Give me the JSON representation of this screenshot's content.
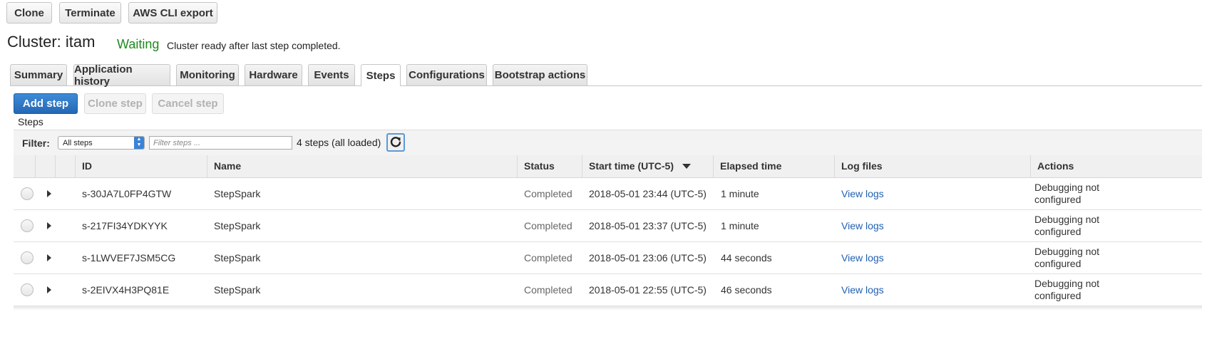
{
  "toolbar": {
    "clone": "Clone",
    "terminate": "Terminate",
    "aws_cli_export": "AWS CLI export"
  },
  "cluster": {
    "title": "Cluster: itam",
    "state": "Waiting",
    "message": "Cluster ready after last step completed."
  },
  "tabs": [
    "Summary",
    "Application history",
    "Monitoring",
    "Hardware",
    "Events",
    "Steps",
    "Configurations",
    "Bootstrap actions"
  ],
  "active_tab": "Steps",
  "step_actions": {
    "add": "Add step",
    "clone": "Clone step",
    "cancel": "Cancel step"
  },
  "steps_section_label": "Steps",
  "filter": {
    "label": "Filter:",
    "selected": "All steps",
    "placeholder": "Filter steps ...",
    "count_text": "4 steps (all loaded)"
  },
  "table": {
    "columns": [
      "ID",
      "Name",
      "Status",
      "Start time (UTC-5)",
      "Elapsed time",
      "Log files",
      "Actions"
    ],
    "sorted_column": "Start time (UTC-5)",
    "sort_direction": "descending",
    "rows": [
      {
        "id": "s-30JA7L0FP4GTW",
        "name": "StepSpark",
        "status": "Completed",
        "start": "2018-05-01 23:44 (UTC-5)",
        "elapsed": "1 minute",
        "logs": "View logs",
        "actions": "Debugging not configured"
      },
      {
        "id": "s-217FI34YDKYYK",
        "name": "StepSpark",
        "status": "Completed",
        "start": "2018-05-01 23:37 (UTC-5)",
        "elapsed": "1 minute",
        "logs": "View logs",
        "actions": "Debugging not configured"
      },
      {
        "id": "s-1LWVEF7JSM5CG",
        "name": "StepSpark",
        "status": "Completed",
        "start": "2018-05-01 23:06 (UTC-5)",
        "elapsed": "44 seconds",
        "logs": "View logs",
        "actions": "Debugging not configured"
      },
      {
        "id": "s-2EIVX4H3PQ81E",
        "name": "StepSpark",
        "status": "Completed",
        "start": "2018-05-01 22:55 (UTC-5)",
        "elapsed": "46 seconds",
        "logs": "View logs",
        "actions": "Debugging not configured"
      }
    ]
  },
  "icons": {
    "refresh": "refresh-icon",
    "sort": "sort-descending-icon",
    "expand": "expand-arrow-icon",
    "select_arrows": "select-arrows-icon"
  },
  "colors": {
    "state_waiting": "#1e8a1e",
    "primary_button": "#2a72c2",
    "link": "#1f5fb2"
  }
}
